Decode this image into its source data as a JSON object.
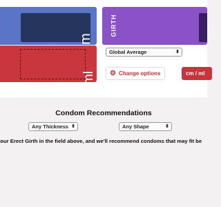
{
  "inputs": {
    "length_unit": "cm",
    "girth_label": "GIRTH",
    "volume_unit": "ml"
  },
  "controls": {
    "comparison_select": "Global Average",
    "change_options_label": "Change options",
    "unit_toggle_label": "cm / ml"
  },
  "recommendations": {
    "title": "Condom Recommendations",
    "thickness_select": "Any Thickness",
    "shape_select": "Any Shape",
    "message": "your Erect Girth in the field above, and we'll recommend condoms that may fit be"
  },
  "colors": {
    "length_card": "#5b75c6",
    "girth_card": "#8a52c6",
    "volume_card": "#c9363e",
    "accent": "#c8343c"
  },
  "icons": {
    "change_options": "gear-icon",
    "select_arrow": "chevron-updown-icon"
  }
}
